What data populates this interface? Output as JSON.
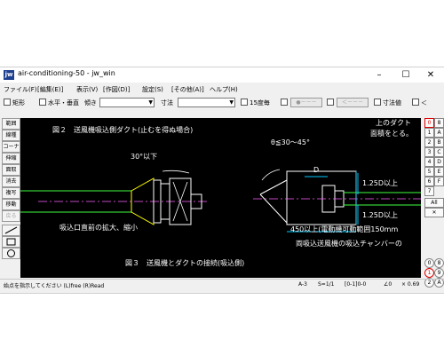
{
  "window": {
    "title": "air-conditioning-50 - jw_win",
    "icon_label": "jw",
    "controls": [
      "–",
      "☐",
      "✕"
    ]
  },
  "menu": [
    "ファイル(F)",
    "[編集(E)]",
    "表示(V)",
    "[作図(D)]",
    "設定(S)",
    "[その他(A)]",
    "ヘルプ(H)"
  ],
  "toolbar": {
    "rect_label": "矩形",
    "horiz_vert_label": "水平・垂直",
    "slope_label": "傾き",
    "dim_label": "寸法",
    "deg15_label": "15度毎",
    "pen_text": "●－－－",
    "arrow_text": "＜－－－",
    "dimval_label": "寸法値",
    "lt_label": "＜"
  },
  "left_tools": [
    "範囲",
    "線種",
    "コーナー",
    "伸縮",
    "面取",
    "消去",
    "複写",
    "移動",
    "戻る"
  ],
  "drawing": {
    "fig2_caption": "図２　送風機吸込側ダクト(止むを得ぬ場合)",
    "corner_text_top": "上のダクト",
    "corner_text_mid": "面積をとる。",
    "angle_left": "30°以下",
    "angle_right": "θ≦30～45°",
    "dim_d": "D",
    "dim_125_top": "1.25D以上",
    "dim_125_bottom": "1.25D以上",
    "note_expand": "吸込口直前の拡大、縮小",
    "note_450": "450以上(電動機可動範囲150mm",
    "note_chamber": "両吸込送風機の吸込チャンバーの",
    "fig3_caption": "図３　送風機とダクトの接続(吸込側)"
  },
  "right_keys": [
    {
      "label": "0",
      "red": true
    },
    {
      "label": "8",
      "red": false
    },
    {
      "label": "1",
      "red": false
    },
    {
      "label": "A",
      "red": false
    },
    {
      "label": "2",
      "red": false
    },
    {
      "label": "B",
      "red": false
    },
    {
      "label": "3",
      "red": false
    },
    {
      "label": "C",
      "red": false
    },
    {
      "label": "4",
      "red": false
    },
    {
      "label": "D",
      "red": false
    },
    {
      "label": "5",
      "red": false
    },
    {
      "label": "E",
      "red": false
    },
    {
      "label": "6",
      "red": false
    },
    {
      "label": "F",
      "red": false
    },
    {
      "label": "7",
      "red": false
    }
  ],
  "right_all": "All",
  "right_lower": [
    "0",
    "8",
    "1",
    "9",
    "2",
    "A"
  ],
  "status": {
    "message": "始点を指示してください (L)free (R)Read",
    "paper": "A-3",
    "scale": "S=1/1",
    "layer": "[0-1]0-0",
    "angle": "∠0",
    "zoom": "× 0.69"
  },
  "colors": {
    "canvas": "#000000",
    "cyan": "#00c8ff",
    "white": "#ffffff",
    "yellow": "#ffff00",
    "magenta": "#ff60ff",
    "green": "#40ff40",
    "red_key": "#e00000"
  }
}
